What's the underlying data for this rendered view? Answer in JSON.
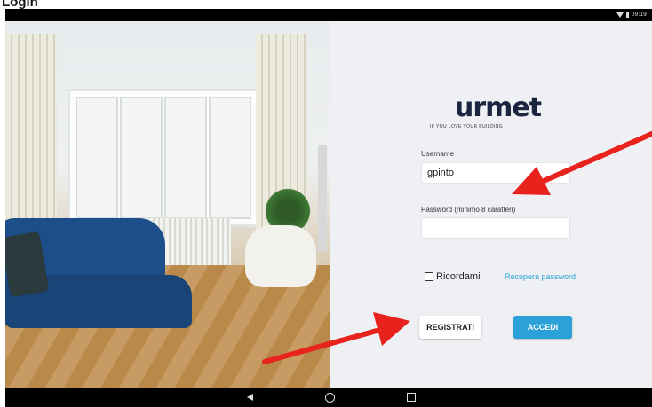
{
  "doc_title": "Login",
  "status_bar": {
    "time": "09:19"
  },
  "brand": {
    "logo_text": "urmet",
    "tagline": "IF YOU LOVE YOUR BUILDING"
  },
  "form": {
    "username_label": "Username",
    "username_value": "gpinto",
    "password_label": "Password (minimo 8 caratteri)",
    "password_value": "",
    "remember_label": "Ricordami",
    "recover_link": "Recupera password"
  },
  "buttons": {
    "register": "REGISTRATI",
    "login": "ACCEDI"
  },
  "colors": {
    "accent": "#2aa1d8",
    "panel_bg": "#eef0f3",
    "arrow": "#e8221c",
    "logo": "#1b2540"
  }
}
